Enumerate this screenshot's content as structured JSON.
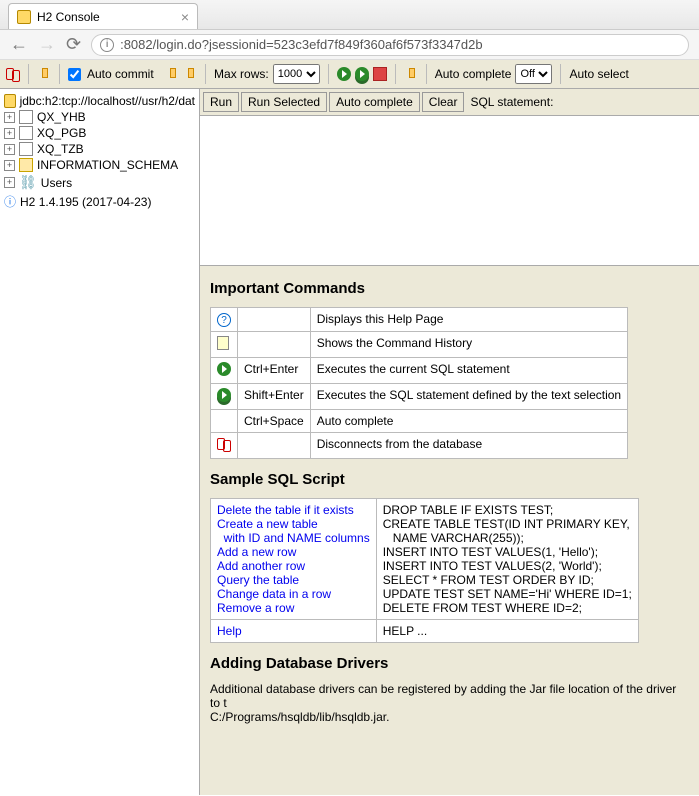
{
  "browser": {
    "tab_title": "H2 Console",
    "url": ":8082/login.do?jsessionid=523c3efd7f849f360af6f573f3347d2b"
  },
  "toolbar": {
    "auto_commit_label": "Auto commit",
    "max_rows_label": "Max rows:",
    "max_rows_value": "1000",
    "auto_complete_label": "Auto complete",
    "auto_complete_value": "Off",
    "auto_select_label": "Auto select"
  },
  "sidebar": {
    "jdbc_url": "jdbc:h2:tcp://localhost//usr/h2/dat",
    "items": [
      {
        "label": "QX_YHB",
        "type": "table"
      },
      {
        "label": "XQ_PGB",
        "type": "table"
      },
      {
        "label": "XQ_TZB",
        "type": "table"
      },
      {
        "label": "INFORMATION_SCHEMA",
        "type": "folder"
      },
      {
        "label": "Users",
        "type": "users"
      }
    ],
    "version": "H2 1.4.195 (2017-04-23)"
  },
  "sqlbar": {
    "run": "Run",
    "run_selected": "Run Selected",
    "auto_complete": "Auto complete",
    "clear": "Clear",
    "statement_label": "SQL statement:"
  },
  "important_commands": {
    "heading": "Important Commands",
    "rows": [
      {
        "icon": "help",
        "key": "",
        "desc": "Displays this Help Page"
      },
      {
        "icon": "history",
        "key": "",
        "desc": "Shows the Command History"
      },
      {
        "icon": "run",
        "key": "Ctrl+Enter",
        "desc": "Executes the current SQL statement"
      },
      {
        "icon": "run-sel",
        "key": "Shift+Enter",
        "desc": "Executes the SQL statement defined by the text selection"
      },
      {
        "icon": "",
        "key": "Ctrl+Space",
        "desc": "Auto complete"
      },
      {
        "icon": "disconnect",
        "key": "",
        "desc": "Disconnects from the database"
      }
    ]
  },
  "sample_script": {
    "heading": "Sample SQL Script",
    "rows": [
      {
        "link": "Delete the table if it exists",
        "sql": "DROP TABLE IF EXISTS TEST;"
      },
      {
        "link": "Create a new table\n  with ID and NAME columns",
        "sql": "CREATE TABLE TEST(ID INT PRIMARY KEY,\n   NAME VARCHAR(255));"
      },
      {
        "link": "Add a new row",
        "sql": "INSERT INTO TEST VALUES(1, 'Hello');"
      },
      {
        "link": "Add another row",
        "sql": "INSERT INTO TEST VALUES(2, 'World');"
      },
      {
        "link": "Query the table",
        "sql": "SELECT * FROM TEST ORDER BY ID;"
      },
      {
        "link": "Change data in a row",
        "sql": "UPDATE TEST SET NAME='Hi' WHERE ID=1;"
      },
      {
        "link": "Remove a row",
        "sql": "DELETE FROM TEST WHERE ID=2;"
      }
    ],
    "help_row": {
      "link": "Help",
      "sql": "HELP ..."
    }
  },
  "drivers": {
    "heading": "Adding Database Drivers",
    "text": "Additional database drivers can be registered by adding the Jar file location of the driver to t",
    "path": "C:/Programs/hsqldb/lib/hsqldb.jar."
  }
}
